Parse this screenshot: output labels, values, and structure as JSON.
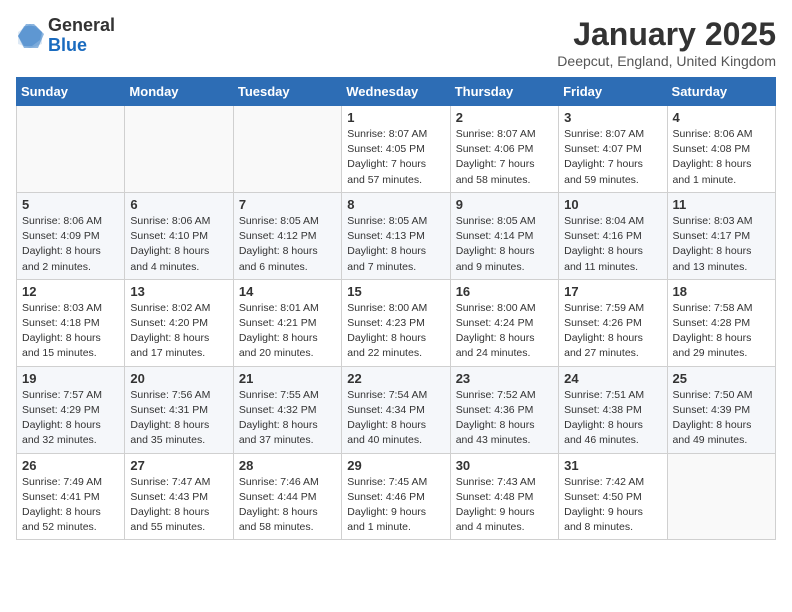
{
  "header": {
    "logo_line1": "General",
    "logo_line2": "Blue",
    "month": "January 2025",
    "location": "Deepcut, England, United Kingdom"
  },
  "weekdays": [
    "Sunday",
    "Monday",
    "Tuesday",
    "Wednesday",
    "Thursday",
    "Friday",
    "Saturday"
  ],
  "weeks": [
    [
      {
        "day": "",
        "info": ""
      },
      {
        "day": "",
        "info": ""
      },
      {
        "day": "",
        "info": ""
      },
      {
        "day": "1",
        "info": "Sunrise: 8:07 AM\nSunset: 4:05 PM\nDaylight: 7 hours and 57 minutes."
      },
      {
        "day": "2",
        "info": "Sunrise: 8:07 AM\nSunset: 4:06 PM\nDaylight: 7 hours and 58 minutes."
      },
      {
        "day": "3",
        "info": "Sunrise: 8:07 AM\nSunset: 4:07 PM\nDaylight: 7 hours and 59 minutes."
      },
      {
        "day": "4",
        "info": "Sunrise: 8:06 AM\nSunset: 4:08 PM\nDaylight: 8 hours and 1 minute."
      }
    ],
    [
      {
        "day": "5",
        "info": "Sunrise: 8:06 AM\nSunset: 4:09 PM\nDaylight: 8 hours and 2 minutes."
      },
      {
        "day": "6",
        "info": "Sunrise: 8:06 AM\nSunset: 4:10 PM\nDaylight: 8 hours and 4 minutes."
      },
      {
        "day": "7",
        "info": "Sunrise: 8:05 AM\nSunset: 4:12 PM\nDaylight: 8 hours and 6 minutes."
      },
      {
        "day": "8",
        "info": "Sunrise: 8:05 AM\nSunset: 4:13 PM\nDaylight: 8 hours and 7 minutes."
      },
      {
        "day": "9",
        "info": "Sunrise: 8:05 AM\nSunset: 4:14 PM\nDaylight: 8 hours and 9 minutes."
      },
      {
        "day": "10",
        "info": "Sunrise: 8:04 AM\nSunset: 4:16 PM\nDaylight: 8 hours and 11 minutes."
      },
      {
        "day": "11",
        "info": "Sunrise: 8:03 AM\nSunset: 4:17 PM\nDaylight: 8 hours and 13 minutes."
      }
    ],
    [
      {
        "day": "12",
        "info": "Sunrise: 8:03 AM\nSunset: 4:18 PM\nDaylight: 8 hours and 15 minutes."
      },
      {
        "day": "13",
        "info": "Sunrise: 8:02 AM\nSunset: 4:20 PM\nDaylight: 8 hours and 17 minutes."
      },
      {
        "day": "14",
        "info": "Sunrise: 8:01 AM\nSunset: 4:21 PM\nDaylight: 8 hours and 20 minutes."
      },
      {
        "day": "15",
        "info": "Sunrise: 8:00 AM\nSunset: 4:23 PM\nDaylight: 8 hours and 22 minutes."
      },
      {
        "day": "16",
        "info": "Sunrise: 8:00 AM\nSunset: 4:24 PM\nDaylight: 8 hours and 24 minutes."
      },
      {
        "day": "17",
        "info": "Sunrise: 7:59 AM\nSunset: 4:26 PM\nDaylight: 8 hours and 27 minutes."
      },
      {
        "day": "18",
        "info": "Sunrise: 7:58 AM\nSunset: 4:28 PM\nDaylight: 8 hours and 29 minutes."
      }
    ],
    [
      {
        "day": "19",
        "info": "Sunrise: 7:57 AM\nSunset: 4:29 PM\nDaylight: 8 hours and 32 minutes."
      },
      {
        "day": "20",
        "info": "Sunrise: 7:56 AM\nSunset: 4:31 PM\nDaylight: 8 hours and 35 minutes."
      },
      {
        "day": "21",
        "info": "Sunrise: 7:55 AM\nSunset: 4:32 PM\nDaylight: 8 hours and 37 minutes."
      },
      {
        "day": "22",
        "info": "Sunrise: 7:54 AM\nSunset: 4:34 PM\nDaylight: 8 hours and 40 minutes."
      },
      {
        "day": "23",
        "info": "Sunrise: 7:52 AM\nSunset: 4:36 PM\nDaylight: 8 hours and 43 minutes."
      },
      {
        "day": "24",
        "info": "Sunrise: 7:51 AM\nSunset: 4:38 PM\nDaylight: 8 hours and 46 minutes."
      },
      {
        "day": "25",
        "info": "Sunrise: 7:50 AM\nSunset: 4:39 PM\nDaylight: 8 hours and 49 minutes."
      }
    ],
    [
      {
        "day": "26",
        "info": "Sunrise: 7:49 AM\nSunset: 4:41 PM\nDaylight: 8 hours and 52 minutes."
      },
      {
        "day": "27",
        "info": "Sunrise: 7:47 AM\nSunset: 4:43 PM\nDaylight: 8 hours and 55 minutes."
      },
      {
        "day": "28",
        "info": "Sunrise: 7:46 AM\nSunset: 4:44 PM\nDaylight: 8 hours and 58 minutes."
      },
      {
        "day": "29",
        "info": "Sunrise: 7:45 AM\nSunset: 4:46 PM\nDaylight: 9 hours and 1 minute."
      },
      {
        "day": "30",
        "info": "Sunrise: 7:43 AM\nSunset: 4:48 PM\nDaylight: 9 hours and 4 minutes."
      },
      {
        "day": "31",
        "info": "Sunrise: 7:42 AM\nSunset: 4:50 PM\nDaylight: 9 hours and 8 minutes."
      },
      {
        "day": "",
        "info": ""
      }
    ]
  ]
}
